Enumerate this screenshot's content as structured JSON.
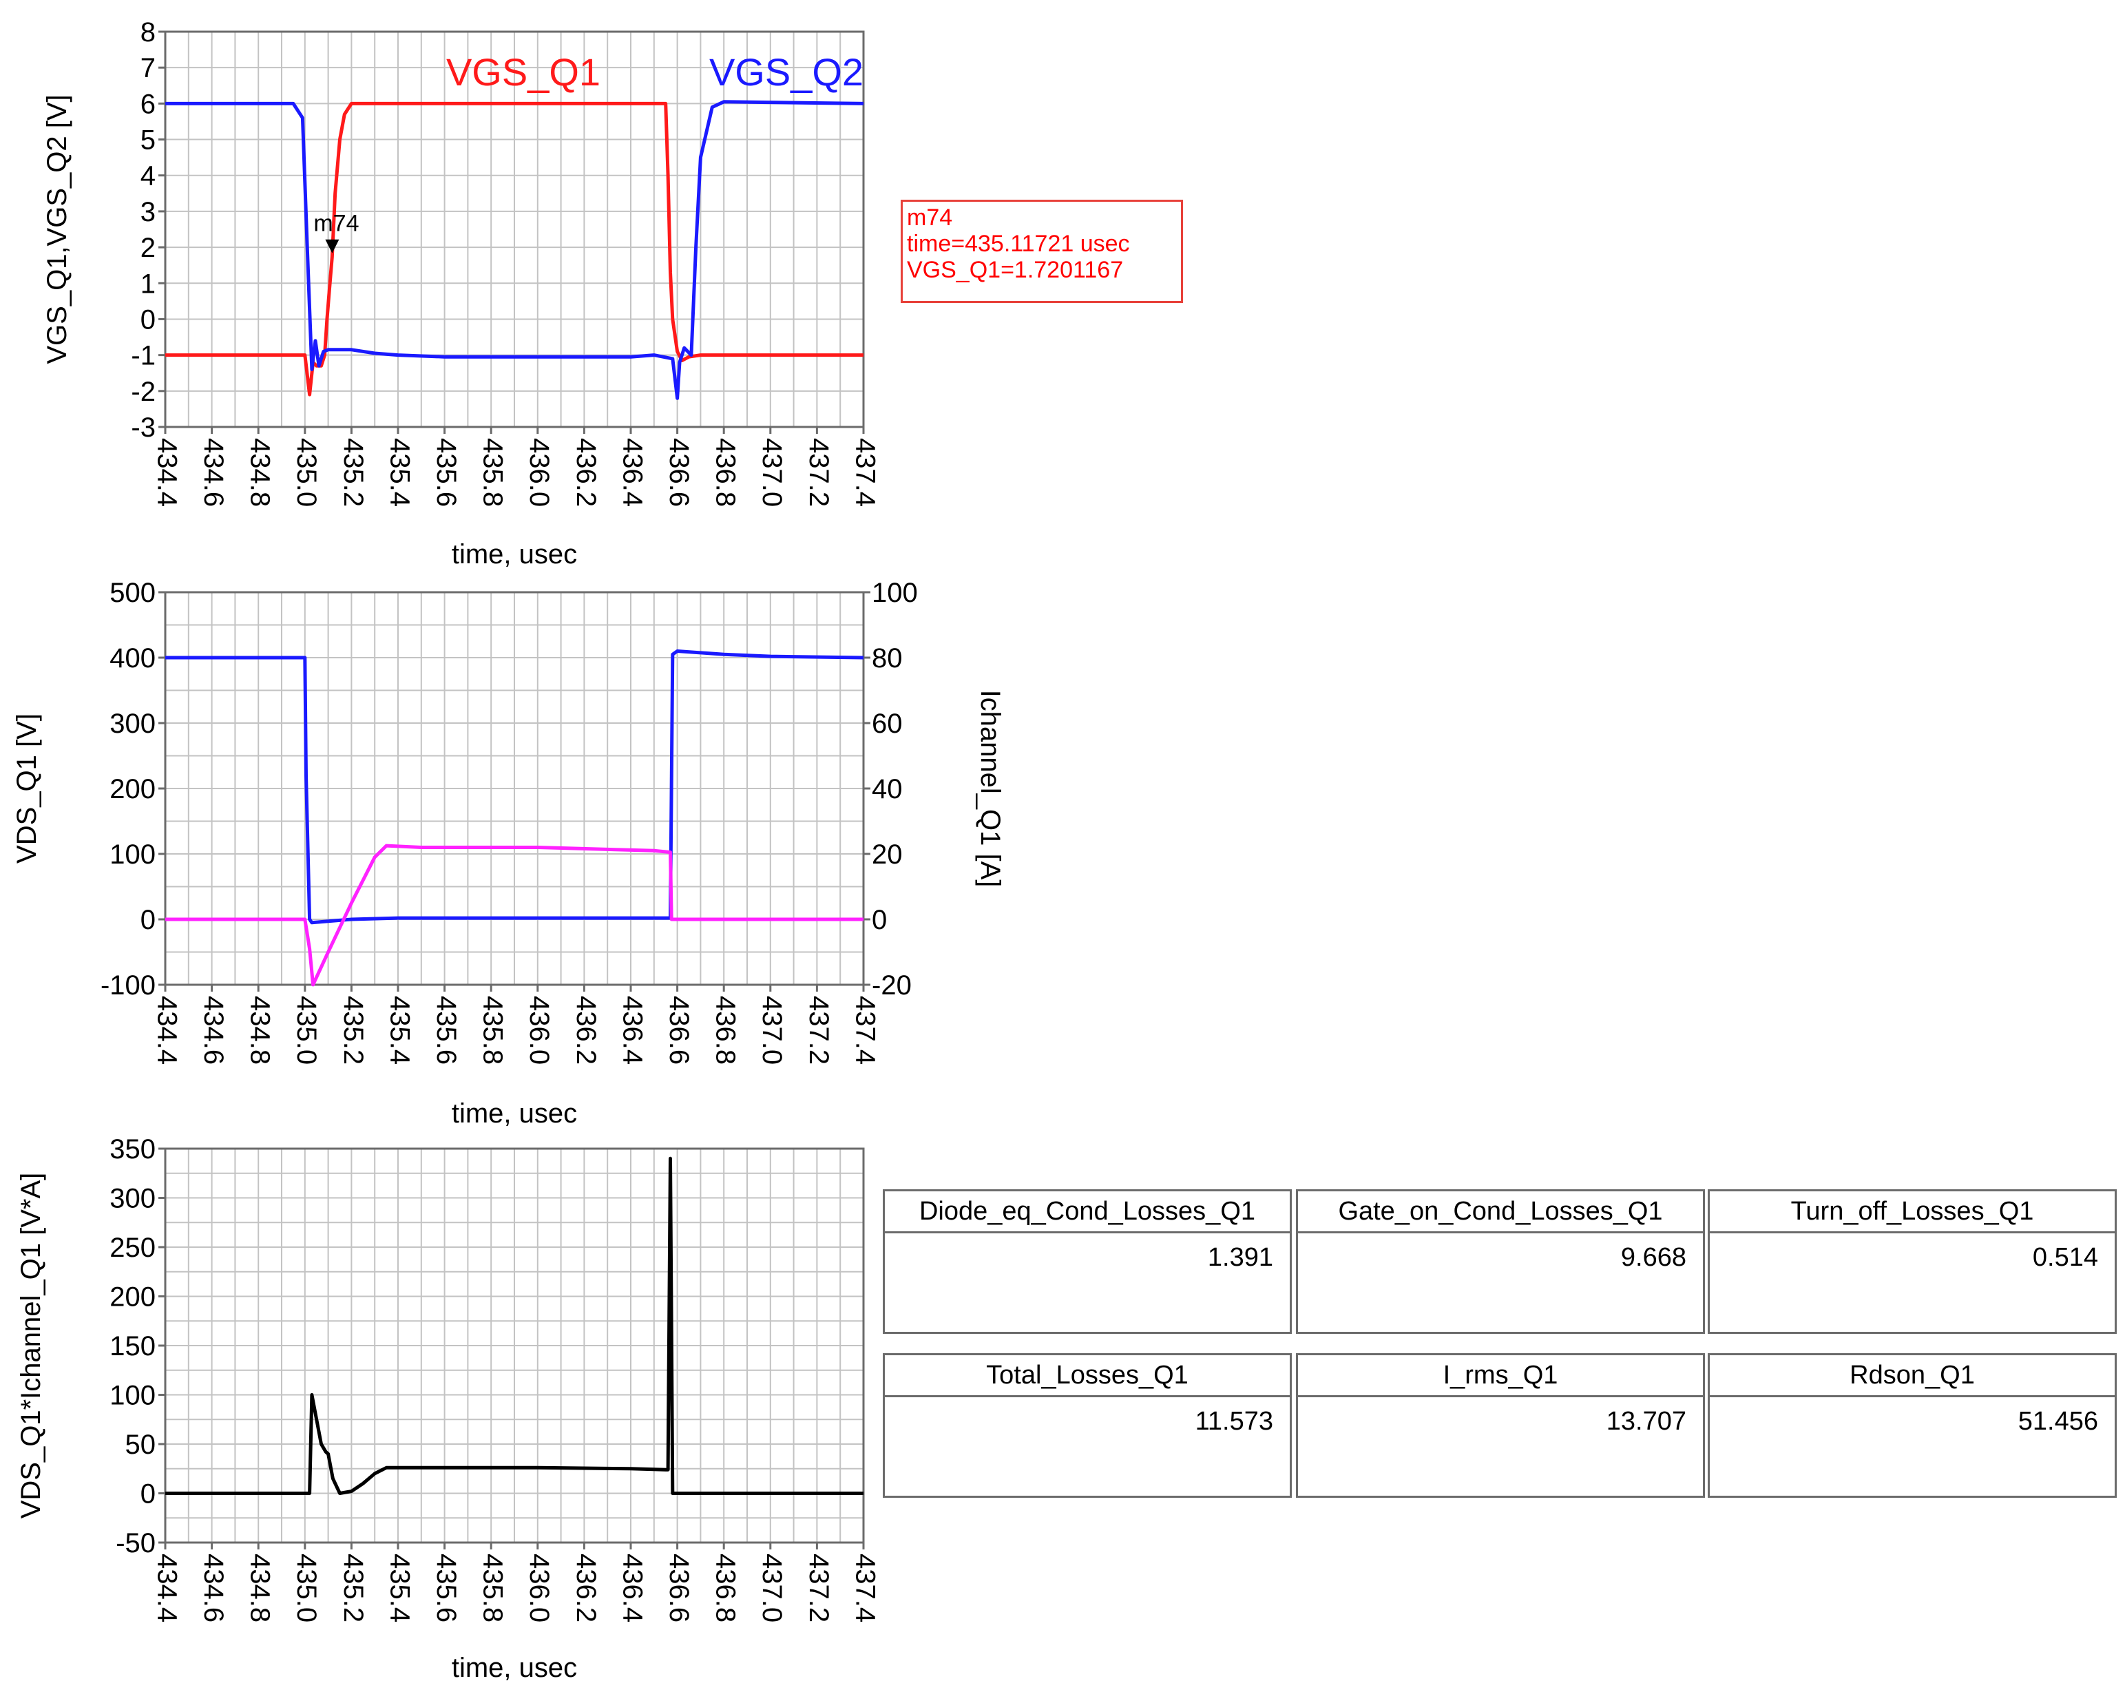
{
  "colors": {
    "red": "#ff1a1a",
    "blue": "#1a1aff",
    "magenta": "#ff22ff",
    "black": "#000000",
    "grid": "#c3c3c3",
    "frame": "#6b6b6b"
  },
  "chart_data": [
    {
      "type": "line",
      "ylabel": "VGS_Q1,VGS_Q2 [V]",
      "xlabel": "time, usec",
      "xlim": [
        434.4,
        437.4
      ],
      "ylim": [
        -3,
        8
      ],
      "x_ticks": [
        "434.4",
        "434.6",
        "434.8",
        "435.0",
        "435.2",
        "435.4",
        "435.6",
        "435.8",
        "436.0",
        "436.2",
        "436.4",
        "436.6",
        "436.8",
        "437.0",
        "437.2",
        "437.4"
      ],
      "y_ticks": [
        "-3",
        "-2",
        "-1",
        "0",
        "1",
        "2",
        "3",
        "4",
        "5",
        "6",
        "7",
        "8"
      ],
      "grid": true,
      "series": [
        {
          "name": "VGS_Q1",
          "color": "#ff1a1a",
          "x": [
            434.4,
            435.0,
            435.02,
            435.035,
            435.05,
            435.07,
            435.085,
            435.095,
            435.11,
            435.117,
            435.13,
            435.15,
            435.17,
            435.2,
            435.25,
            436.55,
            436.56,
            436.57,
            436.58,
            436.6,
            436.62,
            436.65,
            436.7,
            436.75,
            437.4
          ],
          "y": [
            -1,
            -1,
            -2.1,
            -1.2,
            -1.3,
            -1.3,
            -1.0,
            0.0,
            1.2,
            1.72,
            3.5,
            5.0,
            5.7,
            6.0,
            6.0,
            6.0,
            4.0,
            1.3,
            0.0,
            -0.9,
            -1.15,
            -1.05,
            -1.0,
            -1.0,
            -1.0
          ]
        },
        {
          "name": "VGS_Q2",
          "color": "#1a1aff",
          "x": [
            434.4,
            434.95,
            434.99,
            435.01,
            435.03,
            435.045,
            435.06,
            435.08,
            435.1,
            435.2,
            435.3,
            435.4,
            435.6,
            436.0,
            436.4,
            436.5,
            436.58,
            436.6,
            436.61,
            436.63,
            436.66,
            436.68,
            436.7,
            436.75,
            436.8,
            437.4
          ],
          "y": [
            6.0,
            6.0,
            5.6,
            2.0,
            -1.4,
            -0.6,
            -1.3,
            -0.9,
            -0.85,
            -0.85,
            -0.95,
            -1.0,
            -1.05,
            -1.05,
            -1.05,
            -1.0,
            -1.1,
            -2.2,
            -1.2,
            -0.8,
            -1.0,
            2.0,
            4.5,
            5.9,
            6.05,
            6.0
          ]
        }
      ],
      "series_labels": [
        "VGS_Q1",
        "VGS_Q2"
      ],
      "marker": {
        "name": "m74",
        "x": 435.11721,
        "y": 1.7201167,
        "readout": [
          "m74",
          "time=435.11721 usec",
          "VGS_Q1=1.7201167"
        ]
      }
    },
    {
      "type": "line",
      "ylabel": "VDS_Q1 [V]",
      "y2label": "Ichannel_Q1 [A]",
      "xlabel": "time, usec",
      "xlim": [
        434.4,
        437.4
      ],
      "ylim": [
        -100,
        500
      ],
      "y2lim": [
        -20,
        100
      ],
      "x_ticks": [
        "434.4",
        "434.6",
        "434.8",
        "435.0",
        "435.2",
        "435.4",
        "435.6",
        "435.8",
        "436.0",
        "436.2",
        "436.4",
        "436.6",
        "436.8",
        "437.0",
        "437.2",
        "437.4"
      ],
      "y_ticks": [
        "-100",
        "0",
        "100",
        "200",
        "300",
        "400",
        "500"
      ],
      "y2_ticks": [
        "-20",
        "0",
        "20",
        "40",
        "60",
        "80",
        "100"
      ],
      "grid": true,
      "series": [
        {
          "name": "VDS_Q1",
          "color": "#1a1aff",
          "axis": "left",
          "x": [
            434.4,
            435.0,
            435.005,
            435.02,
            435.03,
            435.1,
            435.2,
            435.4,
            436.0,
            436.5,
            436.57,
            436.58,
            436.6,
            436.8,
            437.0,
            437.4
          ],
          "y": [
            400,
            400,
            220,
            0,
            -5,
            -3,
            0,
            2,
            2,
            2,
            2,
            405,
            410,
            405,
            402,
            400
          ]
        },
        {
          "name": "Ichannel_Q1",
          "color": "#ff22ff",
          "axis": "right",
          "x": [
            434.4,
            435.0,
            435.02,
            435.035,
            435.1,
            435.2,
            435.3,
            435.35,
            435.5,
            436.0,
            436.5,
            436.57,
            436.575,
            436.6,
            437.4
          ],
          "y": [
            0,
            0,
            -9,
            -20,
            -10,
            5,
            19,
            22.5,
            22,
            22,
            21,
            20.5,
            0,
            0,
            0
          ]
        }
      ]
    },
    {
      "type": "line",
      "ylabel": "VDS_Q1*Ichannel_Q1 [V*A]",
      "xlabel": "time, usec",
      "xlim": [
        434.4,
        437.4
      ],
      "ylim": [
        -50,
        350
      ],
      "x_ticks": [
        "434.4",
        "434.6",
        "434.8",
        "435.0",
        "435.2",
        "435.4",
        "435.6",
        "435.8",
        "436.0",
        "436.2",
        "436.4",
        "436.6",
        "436.8",
        "437.0",
        "437.2",
        "437.4"
      ],
      "y_ticks": [
        "-50",
        "0",
        "50",
        "100",
        "150",
        "200",
        "250",
        "300",
        "350"
      ],
      "grid": true,
      "series": [
        {
          "name": "VDS_Q1*Ichannel_Q1",
          "color": "#000000",
          "x": [
            434.4,
            435.0,
            435.02,
            435.03,
            435.05,
            435.07,
            435.09,
            435.1,
            435.12,
            435.15,
            435.2,
            435.25,
            435.3,
            435.35,
            435.5,
            436.0,
            436.4,
            436.55,
            436.56,
            436.57,
            436.58,
            437.4
          ],
          "y": [
            0,
            0,
            0,
            100,
            75,
            50,
            42,
            40,
            15,
            0,
            2,
            10,
            20,
            26,
            26,
            26,
            25,
            24,
            24,
            340,
            0,
            0
          ]
        }
      ]
    }
  ],
  "tables": [
    {
      "header": "Diode_eq_Cond_Losses_Q1",
      "value": "1.391"
    },
    {
      "header": "Gate_on_Cond_Losses_Q1",
      "value": "9.668"
    },
    {
      "header": "Turn_off_Losses_Q1",
      "value": "0.514"
    },
    {
      "header": "Total_Losses_Q1",
      "value": "11.573"
    },
    {
      "header": "I_rms_Q1",
      "value": "13.707"
    },
    {
      "header": "Rdson_Q1",
      "value": "51.456"
    }
  ]
}
